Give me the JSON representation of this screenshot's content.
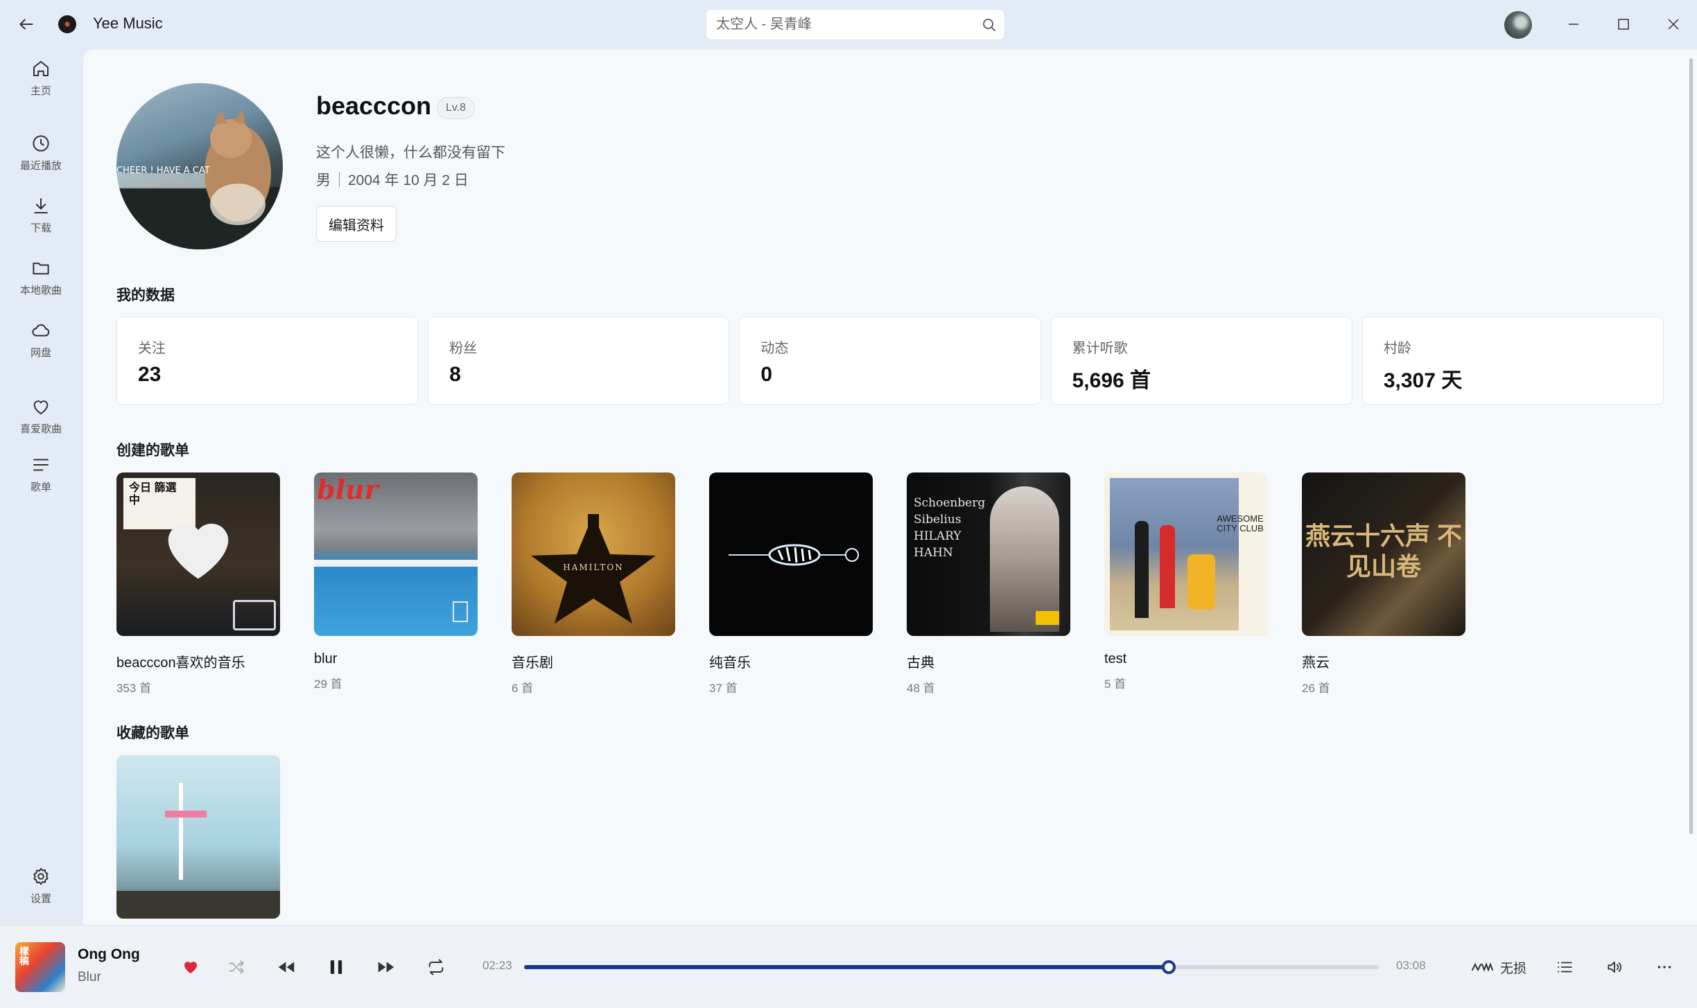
{
  "app": {
    "title": "Yee Music"
  },
  "search": {
    "placeholder": "太空人 - 吴青峰"
  },
  "sidebar": {
    "items": [
      {
        "label": "主页",
        "icon": "home-icon"
      },
      {
        "label": "最近播放",
        "icon": "clock-icon"
      },
      {
        "label": "下载",
        "icon": "download-icon"
      },
      {
        "label": "本地歌曲",
        "icon": "folder-icon"
      },
      {
        "label": "网盘",
        "icon": "cloud-icon"
      },
      {
        "label": "喜爱歌曲",
        "icon": "heart-icon"
      },
      {
        "label": "歌单",
        "icon": "list-icon"
      },
      {
        "label": "设置",
        "icon": "gear-icon"
      }
    ]
  },
  "profile": {
    "username": "beacccon",
    "level": "Lv.8",
    "bio": "这个人很懒，什么都没有留下",
    "gender": "男",
    "birthday": "2004 年 10 月 2 日",
    "edit_label": "编辑资料",
    "avatar_text": "CHEER ! HAVE A CAT"
  },
  "stats_section": {
    "title": "我的数据",
    "items": [
      {
        "label": "关注",
        "value": "23"
      },
      {
        "label": "粉丝",
        "value": "8"
      },
      {
        "label": "动态",
        "value": "0"
      },
      {
        "label": "累计听歌",
        "value": "5,696 首"
      },
      {
        "label": "村龄",
        "value": "3,307 天"
      }
    ]
  },
  "created_section": {
    "title": "创建的歌单",
    "playlists": [
      {
        "name": "beacccon喜欢的音乐",
        "count": "353 首",
        "cover_text": "今日 篩選中"
      },
      {
        "name": "blur",
        "count": "29 首",
        "cover_text": "blur"
      },
      {
        "name": "音乐剧",
        "count": "6 首",
        "cover_text": "HAMILTON"
      },
      {
        "name": "纯音乐",
        "count": "37 首",
        "cover_text": ""
      },
      {
        "name": "古典",
        "count": "48 首",
        "cover_text": "Schoenberg Sibelius HILARY HAHN"
      },
      {
        "name": "test",
        "count": "5 首",
        "cover_text": "AWESOME CITY CLUB"
      },
      {
        "name": "燕云",
        "count": "26 首",
        "cover_text": "燕云十六声 不见山卷"
      }
    ]
  },
  "collected_section": {
    "title": "收藏的歌单"
  },
  "player": {
    "title": "Ong Ong",
    "artist": "Blur",
    "current_time": "02:23",
    "total_time": "03:08",
    "progress": 0.754,
    "quality_label": "无损",
    "liked": true,
    "colors": {
      "accent": "#1b3a8c",
      "heart": "#e0263c"
    }
  }
}
